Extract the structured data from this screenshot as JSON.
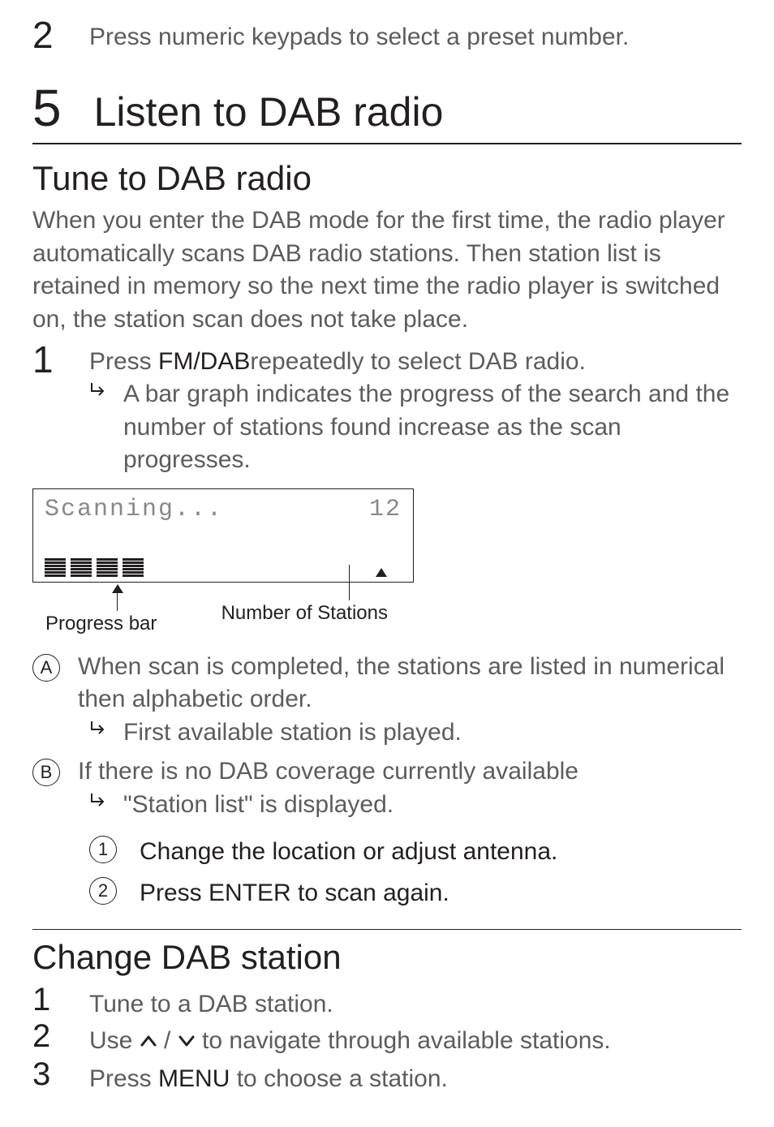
{
  "top_step": {
    "num": "2",
    "text": "Press numeric keypads to select a preset number."
  },
  "chapter": {
    "num": "5",
    "title": "Listen to DAB radio"
  },
  "section1": {
    "heading": "Tune to DAB radio",
    "intro": "When you enter the DAB mode for the first time, the radio player automatically scans DAB radio stations. Then station list is retained in memory so the next time the radio player is switched on, the station scan does not take place.",
    "step1": {
      "num": "1",
      "text_prefix": "Press ",
      "text_bold": "FM/DAB",
      "text_suffix": "repeatedly to select DAB radio.",
      "result": "A bar graph indicates the progress of the search and the number of stations found increase as the scan progresses."
    },
    "diagram": {
      "lcd_text": "Scanning...",
      "lcd_count": "12",
      "label_progress": "Progress bar",
      "label_number": "Number of Stations"
    },
    "optA": {
      "letter": "A",
      "text": "When scan is completed, the stations are listed in numerical then alphabetic order.",
      "result": "First available station is played."
    },
    "optB": {
      "letter": "B",
      "text": "If there is no DAB coverage currently available",
      "result": "\"Station list\" is displayed.",
      "sub1": {
        "num": "1",
        "text": "Change the location or adjust antenna."
      },
      "sub2": {
        "num": "2",
        "text": "Press ENTER to scan again."
      }
    }
  },
  "section2": {
    "heading": "Change DAB station",
    "step1": {
      "num": "1",
      "text": "Tune to a DAB station."
    },
    "step2": {
      "num": "2",
      "prefix": "Use  ",
      "mid": " /",
      "suffix": "  to navigate through available stations."
    },
    "step3": {
      "num": "3",
      "prefix": "Press ",
      "bold": "MENU",
      "suffix": " to choose a station."
    }
  }
}
